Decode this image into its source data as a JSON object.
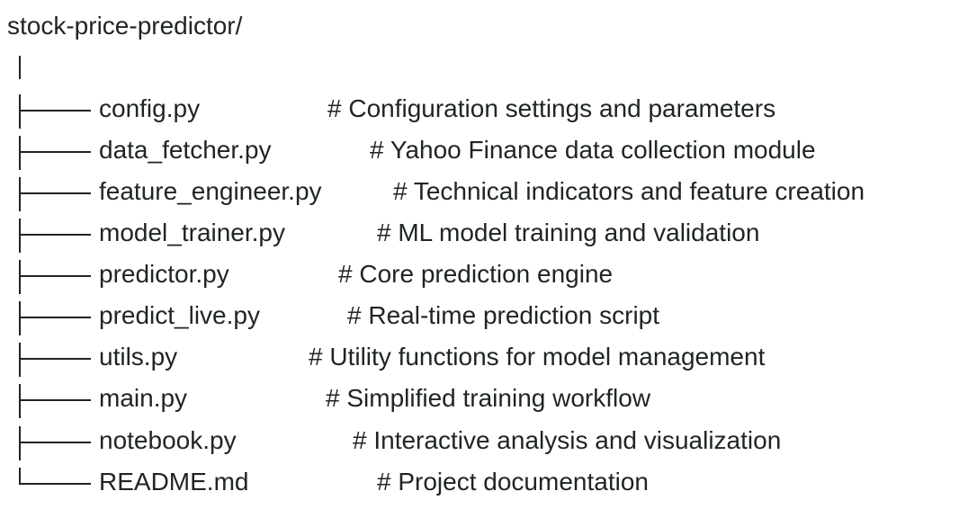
{
  "root": "stock-price-predictor/",
  "files": [
    {
      "name": "config.py",
      "comment": "# Configuration settings and parameters"
    },
    {
      "name": "data_fetcher.py",
      "comment": "# Yahoo Finance data collection module"
    },
    {
      "name": "feature_engineer.py",
      "comment": "# Technical indicators and feature creation"
    },
    {
      "name": "model_trainer.py",
      "comment": "# ML model training and validation"
    },
    {
      "name": "predictor.py",
      "comment": "# Core prediction engine"
    },
    {
      "name": "predict_live.py",
      "comment": "# Real-time prediction script"
    },
    {
      "name": "utils.py",
      "comment": "# Utility functions for model management"
    },
    {
      "name": "main.py",
      "comment": "# Simplified training workflow"
    },
    {
      "name": "notebook.py",
      "comment": "# Interactive analysis and visualization"
    },
    {
      "name": "README.md",
      "comment": "# Project documentation"
    }
  ]
}
